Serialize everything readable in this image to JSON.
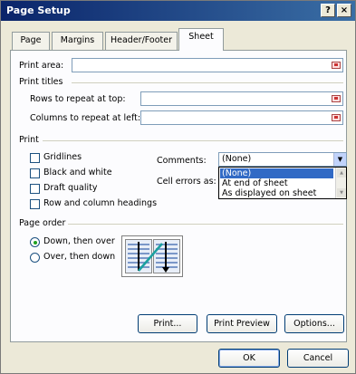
{
  "window": {
    "title": "Page Setup",
    "help": "?",
    "close": "×"
  },
  "tabs": [
    {
      "label": "Page"
    },
    {
      "label": "Margins"
    },
    {
      "label": "Header/Footer"
    },
    {
      "label": "Sheet"
    }
  ],
  "active_tab": "Sheet",
  "print_area": {
    "label": "Print area:",
    "value": ""
  },
  "print_titles": {
    "heading": "Print titles",
    "rows_label": "Rows to repeat at top:",
    "rows_value": "",
    "cols_label": "Columns to repeat at left:",
    "cols_value": ""
  },
  "print": {
    "heading": "Print",
    "gridlines": {
      "label": "Gridlines",
      "checked": false
    },
    "black_white": {
      "label": "Black and white",
      "checked": false
    },
    "draft_quality": {
      "label": "Draft quality",
      "checked": false
    },
    "row_col_headings": {
      "label": "Row and column headings",
      "checked": false
    },
    "comments_label": "Comments:",
    "comments_value": "(None)",
    "cell_errors_label": "Cell errors as:",
    "comments_options": [
      "(None)",
      "At end of sheet",
      "As displayed on sheet"
    ]
  },
  "page_order": {
    "heading": "Page order",
    "down_then_over": "Down, then over",
    "over_then_down": "Over, then down",
    "selected": "Down, then over"
  },
  "buttons": {
    "print": "Print...",
    "print_preview": "Print Preview",
    "options": "Options...",
    "ok": "OK",
    "cancel": "Cancel"
  }
}
